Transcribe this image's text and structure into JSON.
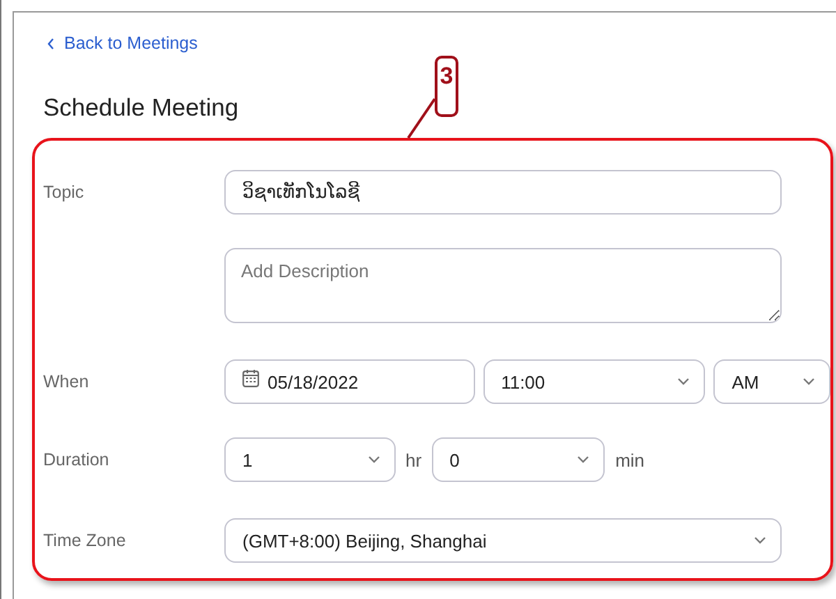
{
  "back_link": {
    "label": "Back to Meetings"
  },
  "title": "Schedule Meeting",
  "annotation": {
    "number": "3"
  },
  "form": {
    "topic": {
      "label": "Topic",
      "value": "ວິຊາເທັກໂນໂລຊີ"
    },
    "description": {
      "placeholder": "Add Description"
    },
    "when": {
      "label": "When",
      "date": "05/18/2022",
      "time": "11:00",
      "period": "AM"
    },
    "duration": {
      "label": "Duration",
      "hours": "1",
      "hours_unit": "hr",
      "minutes": "0",
      "minutes_unit": "min"
    },
    "time_zone": {
      "label": "Time Zone",
      "value": "(GMT+8:00) Beijing, Shanghai"
    }
  }
}
